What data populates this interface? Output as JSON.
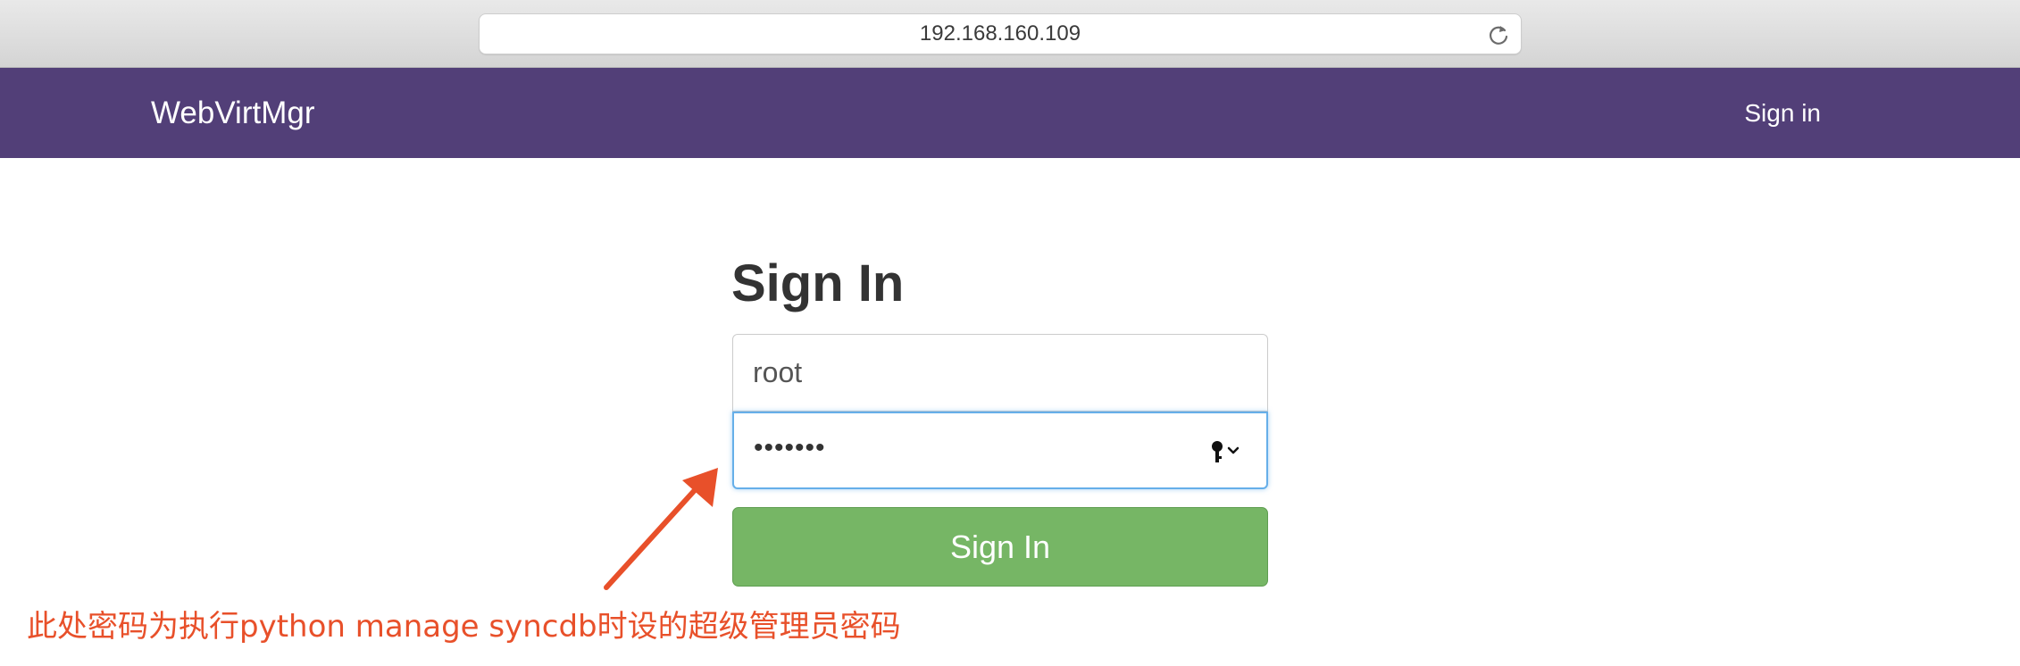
{
  "browser": {
    "url": "192.168.160.109",
    "reload_icon": "reload-icon"
  },
  "navbar": {
    "brand": "WebVirtMgr",
    "sign_in_link": "Sign in",
    "background_color": "#523f78"
  },
  "form": {
    "title": "Sign In",
    "username_value": "root",
    "password_masked": "•••••••",
    "password_icon": "key-icon",
    "submit_label": "Sign In",
    "submit_color": "#76b665"
  },
  "annotation": {
    "text": "此处密码为执行python manage syncdb时设的超级管理员密码",
    "color": "#e8502a",
    "arrow_icon": "arrow-icon"
  }
}
